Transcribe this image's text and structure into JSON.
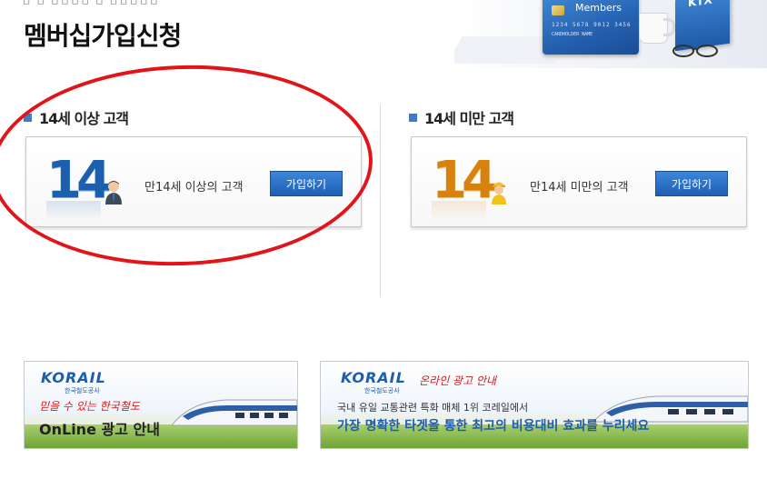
{
  "header": {
    "top_remnant": "ㅁ   ㅁ  ㅁㅁㅁㅁ ㅁ  ㅁㅁㅁㅁㅁ",
    "page_title": "멤버십가입신청",
    "card_brand": "Members",
    "card_number": "1234  5678  9012  3456",
    "card_name": "CARDHOLDER  NAME",
    "book_label": "KTX"
  },
  "sections": {
    "over14": {
      "heading": "14세 이상 고객",
      "number": "14",
      "label": "만14세 이상의 고객",
      "button": "가입하기"
    },
    "under14": {
      "heading": "14세 미만 고객",
      "number": "14",
      "label": "만14세 미만의 고객",
      "button": "가입하기"
    }
  },
  "banners": {
    "left": {
      "logo": "KORAIL",
      "logo_sub": "한국철도공사",
      "slogan": "믿을 수 있는 한국철도",
      "title": "OnLine 광고 안내"
    },
    "right": {
      "logo": "KORAIL",
      "logo_sub": "한국철도공사",
      "slogan": "온라인 광고 안내",
      "desc": "국내 유일 교통관련 특화 매체 1위 코레일에서",
      "main": "가장 명확한 타겟을 통한 최고의 비용대비 효과를 누리세요"
    }
  },
  "colors": {
    "accent_blue": "#1f5fb4",
    "over14_number": "#1b5fae",
    "under14_number": "#d8820e",
    "annotation_red": "#e2141a"
  }
}
